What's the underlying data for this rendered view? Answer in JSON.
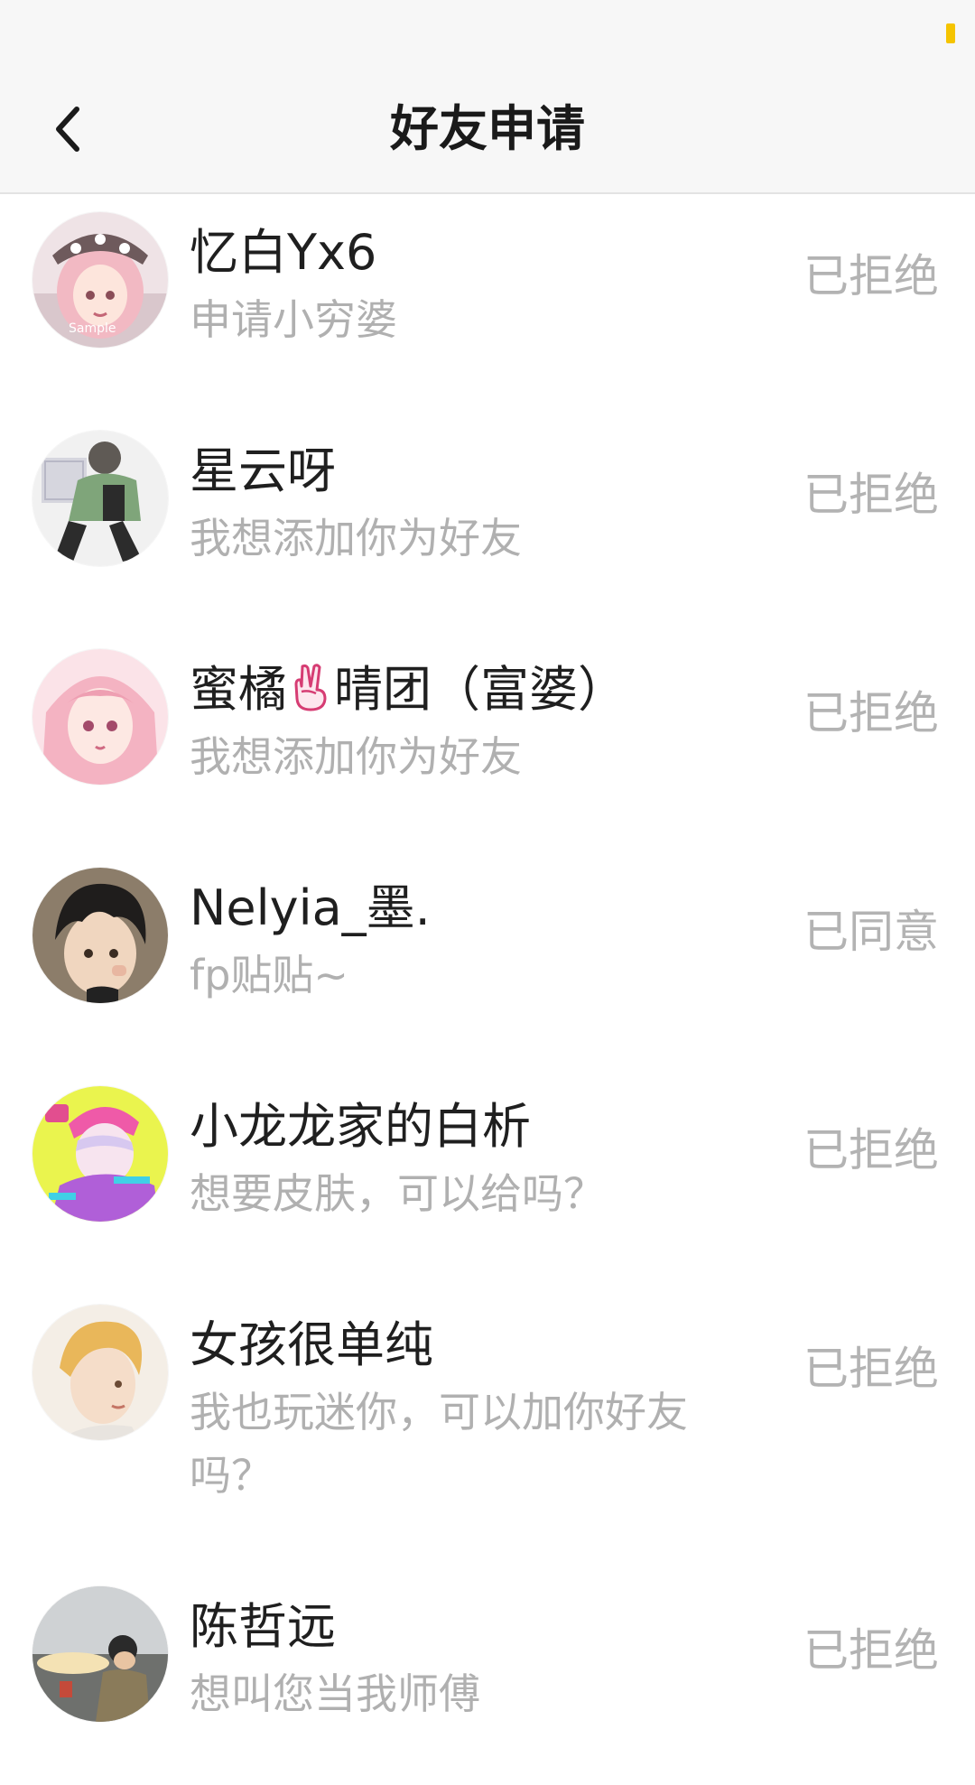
{
  "header": {
    "title": "好友申请",
    "back_icon": "chevron-left-icon"
  },
  "requests": [
    {
      "name": "忆白Yx6",
      "message": "申请小穷婆",
      "status": "已拒绝",
      "avatar_watermark": "Sample"
    },
    {
      "name": "星云呀",
      "message": "我想添加你为好友",
      "status": "已拒绝"
    },
    {
      "name_before": "蜜橘",
      "name_icon": "victory-hand-icon",
      "name_after": "晴团（富婆）",
      "message": "我想添加你为好友",
      "status": "已拒绝"
    },
    {
      "name": "Nelyia_墨.",
      "message": "fp贴贴~",
      "status": "已同意"
    },
    {
      "name": "小龙龙家的白析",
      "message": "想要皮肤，可以给吗？",
      "status": "已拒绝"
    },
    {
      "name": "女孩很单纯",
      "message": "我也玩迷你，可以加你好友吗？",
      "status": "已拒绝"
    },
    {
      "name": "陈哲远",
      "message": "想叫您当我师傅",
      "status": "已拒绝"
    }
  ],
  "colors": {
    "accent": "#f5c400",
    "status_text": "#b3b3b3",
    "message_text": "#b0b0b0",
    "name_text": "#1f1f1f"
  }
}
